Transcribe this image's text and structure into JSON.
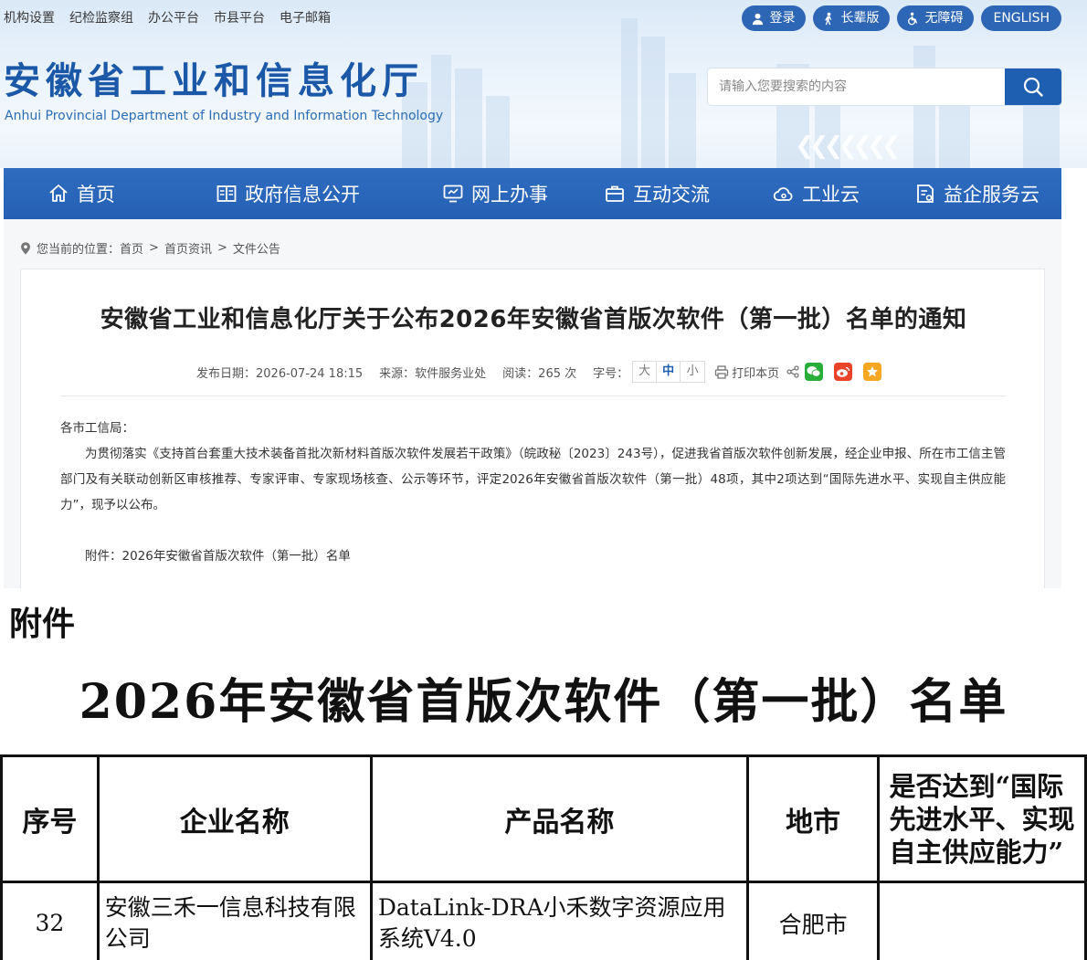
{
  "header": {
    "top_links": [
      "机构设置",
      "纪检监察组",
      "办公平台",
      "市县平台",
      "电子邮箱"
    ],
    "top_buttons": {
      "login": "登录",
      "elder": "长辈版",
      "accessible": "无障碍",
      "english": "ENGLISH"
    },
    "site_title": "安徽省工业和信息化厅",
    "site_subtitle": "Anhui Provincial Department of Industry and Information Technology",
    "search_placeholder": "请输入您要搜索的内容"
  },
  "nav": {
    "items": [
      {
        "label": "首页",
        "icon": "home-icon"
      },
      {
        "label": "政府信息公开",
        "icon": "book-icon"
      },
      {
        "label": "网上办事",
        "icon": "monitor-icon"
      },
      {
        "label": "互动交流",
        "icon": "briefcase-icon"
      },
      {
        "label": "工业云",
        "icon": "cloud-icon"
      },
      {
        "label": "益企服务云",
        "icon": "document-icon"
      }
    ]
  },
  "breadcrumb": {
    "prefix": "您当前的位置：",
    "items": [
      "首页",
      "首页资讯",
      "文件公告"
    ],
    "separator": ">"
  },
  "article": {
    "title": "安徽省工业和信息化厅关于公布2026年安徽省首版次软件（第一批）名单的通知",
    "publish_date": "发布日期：2026-07-24 18:15",
    "source": "来源：软件服务业处",
    "reads": "阅读：265 次",
    "font_size_label": "字号：",
    "font_sizes": [
      "大",
      "中",
      "小"
    ],
    "font_size_selected": "中",
    "print_label": "打印本页",
    "salutation": "各市工信局：",
    "paragraph": "为贯彻落实《支持首台套重大技术装备首批次新材料首版次软件发展若干政策》（皖政秘〔2023〕243号），促进我省首版次软件创新发展，经企业申报、所在市工信主管部门及有关联动创新区审核推荐、专家评审、专家现场核查、公示等环节，评定2026年安徽省首版次软件（第一批）48项，其中2项达到“国际先进水平、实现自主供应能力”，现予以公布。",
    "attachment": "附件：2026年安徽省首版次软件（第一批）名单"
  },
  "document": {
    "label": "附件",
    "title": "2026年安徽省首版次软件（第一批）名单",
    "columns": [
      "序号",
      "企业名称",
      "产品名称",
      "地市",
      "是否达到“国际先进水平、实现自主供应能力”"
    ],
    "rows": [
      [
        "32",
        "安徽三禾一信息科技有限公司",
        "DataLink-DRA小禾数字资源应用系统V4.0",
        "合肥市",
        ""
      ]
    ]
  },
  "colors": {
    "brand_blue": "#2560b4",
    "title_blue": "#1b58a8",
    "wechat": "#2aae3a",
    "weibo": "#e8442a",
    "favorite": "#f5a623"
  }
}
